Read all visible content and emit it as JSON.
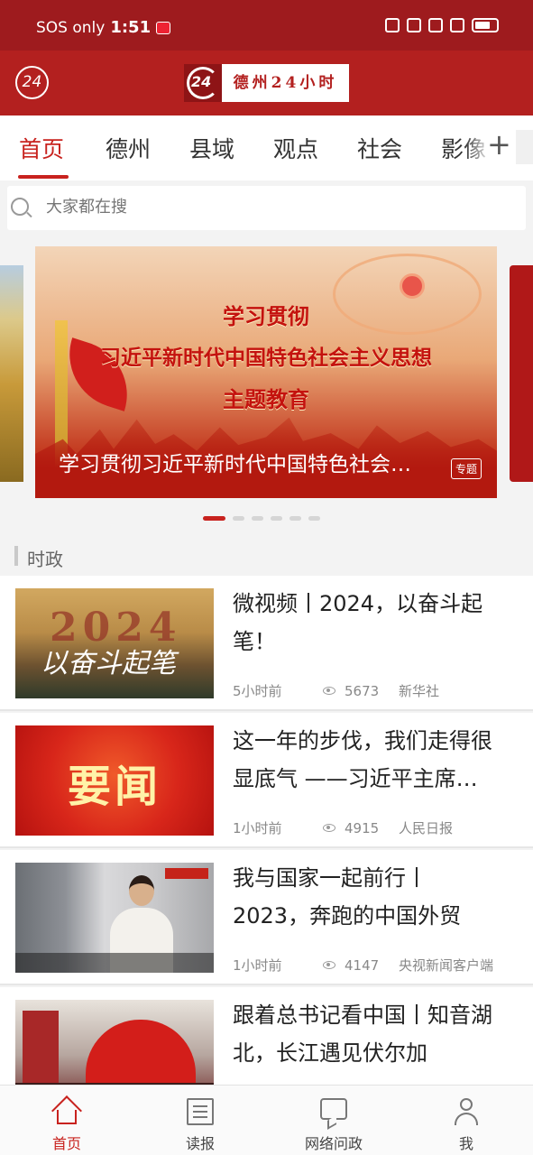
{
  "status_bar": {
    "carrier": "SOS only",
    "time": "1:51"
  },
  "header": {
    "badge": "24",
    "logo_mark": "24",
    "logo_text": "德州24小时"
  },
  "tabs": [
    {
      "label": "首页",
      "active": true
    },
    {
      "label": "德州"
    },
    {
      "label": "县域"
    },
    {
      "label": "观点"
    },
    {
      "label": "社会"
    },
    {
      "label": "影像"
    }
  ],
  "tab_add": "+",
  "search": {
    "placeholder": "大家都在搜"
  },
  "banner": {
    "headline_1": "学习贯彻",
    "headline_2": "习近平新时代中国特色社会主义思想",
    "headline_3": "主题教育",
    "caption": "学习贯彻习近平新时代中国特色社会主义思想主题教育",
    "tag": "专题",
    "dots": 6,
    "active_dot": 0
  },
  "section": {
    "title": "时政"
  },
  "news": [
    {
      "title": "微视频丨2024，以奋斗起笔！",
      "time": "5小时前",
      "views": "5673",
      "source": "新华社",
      "thumb_big": "2024",
      "thumb_script": "以奋斗起笔"
    },
    {
      "title": "这一年的步伐，我们走得很显底气 ——习近平主席…",
      "time": "1小时前",
      "views": "4915",
      "source": "人民日报",
      "thumb_big": "要闻"
    },
    {
      "title": "我与国家一起前行丨2023，奔跑的中国外贸",
      "time": "1小时前",
      "views": "4147",
      "source": "央视新闻客户端"
    },
    {
      "title": "跟着总书记看中国丨知音湖北，长江遇见伏尔加",
      "time": "",
      "views": "",
      "source": ""
    }
  ],
  "bottom_nav": [
    {
      "label": "首页",
      "icon": "home-icon",
      "active": true
    },
    {
      "label": "读报",
      "icon": "newspaper-icon"
    },
    {
      "label": "网络问政",
      "icon": "chat-icon"
    },
    {
      "label": "我",
      "icon": "user-icon"
    }
  ],
  "colors": {
    "brand_red": "#c8221e",
    "header_red": "#b3201f",
    "status_red": "#9e1b1e"
  }
}
